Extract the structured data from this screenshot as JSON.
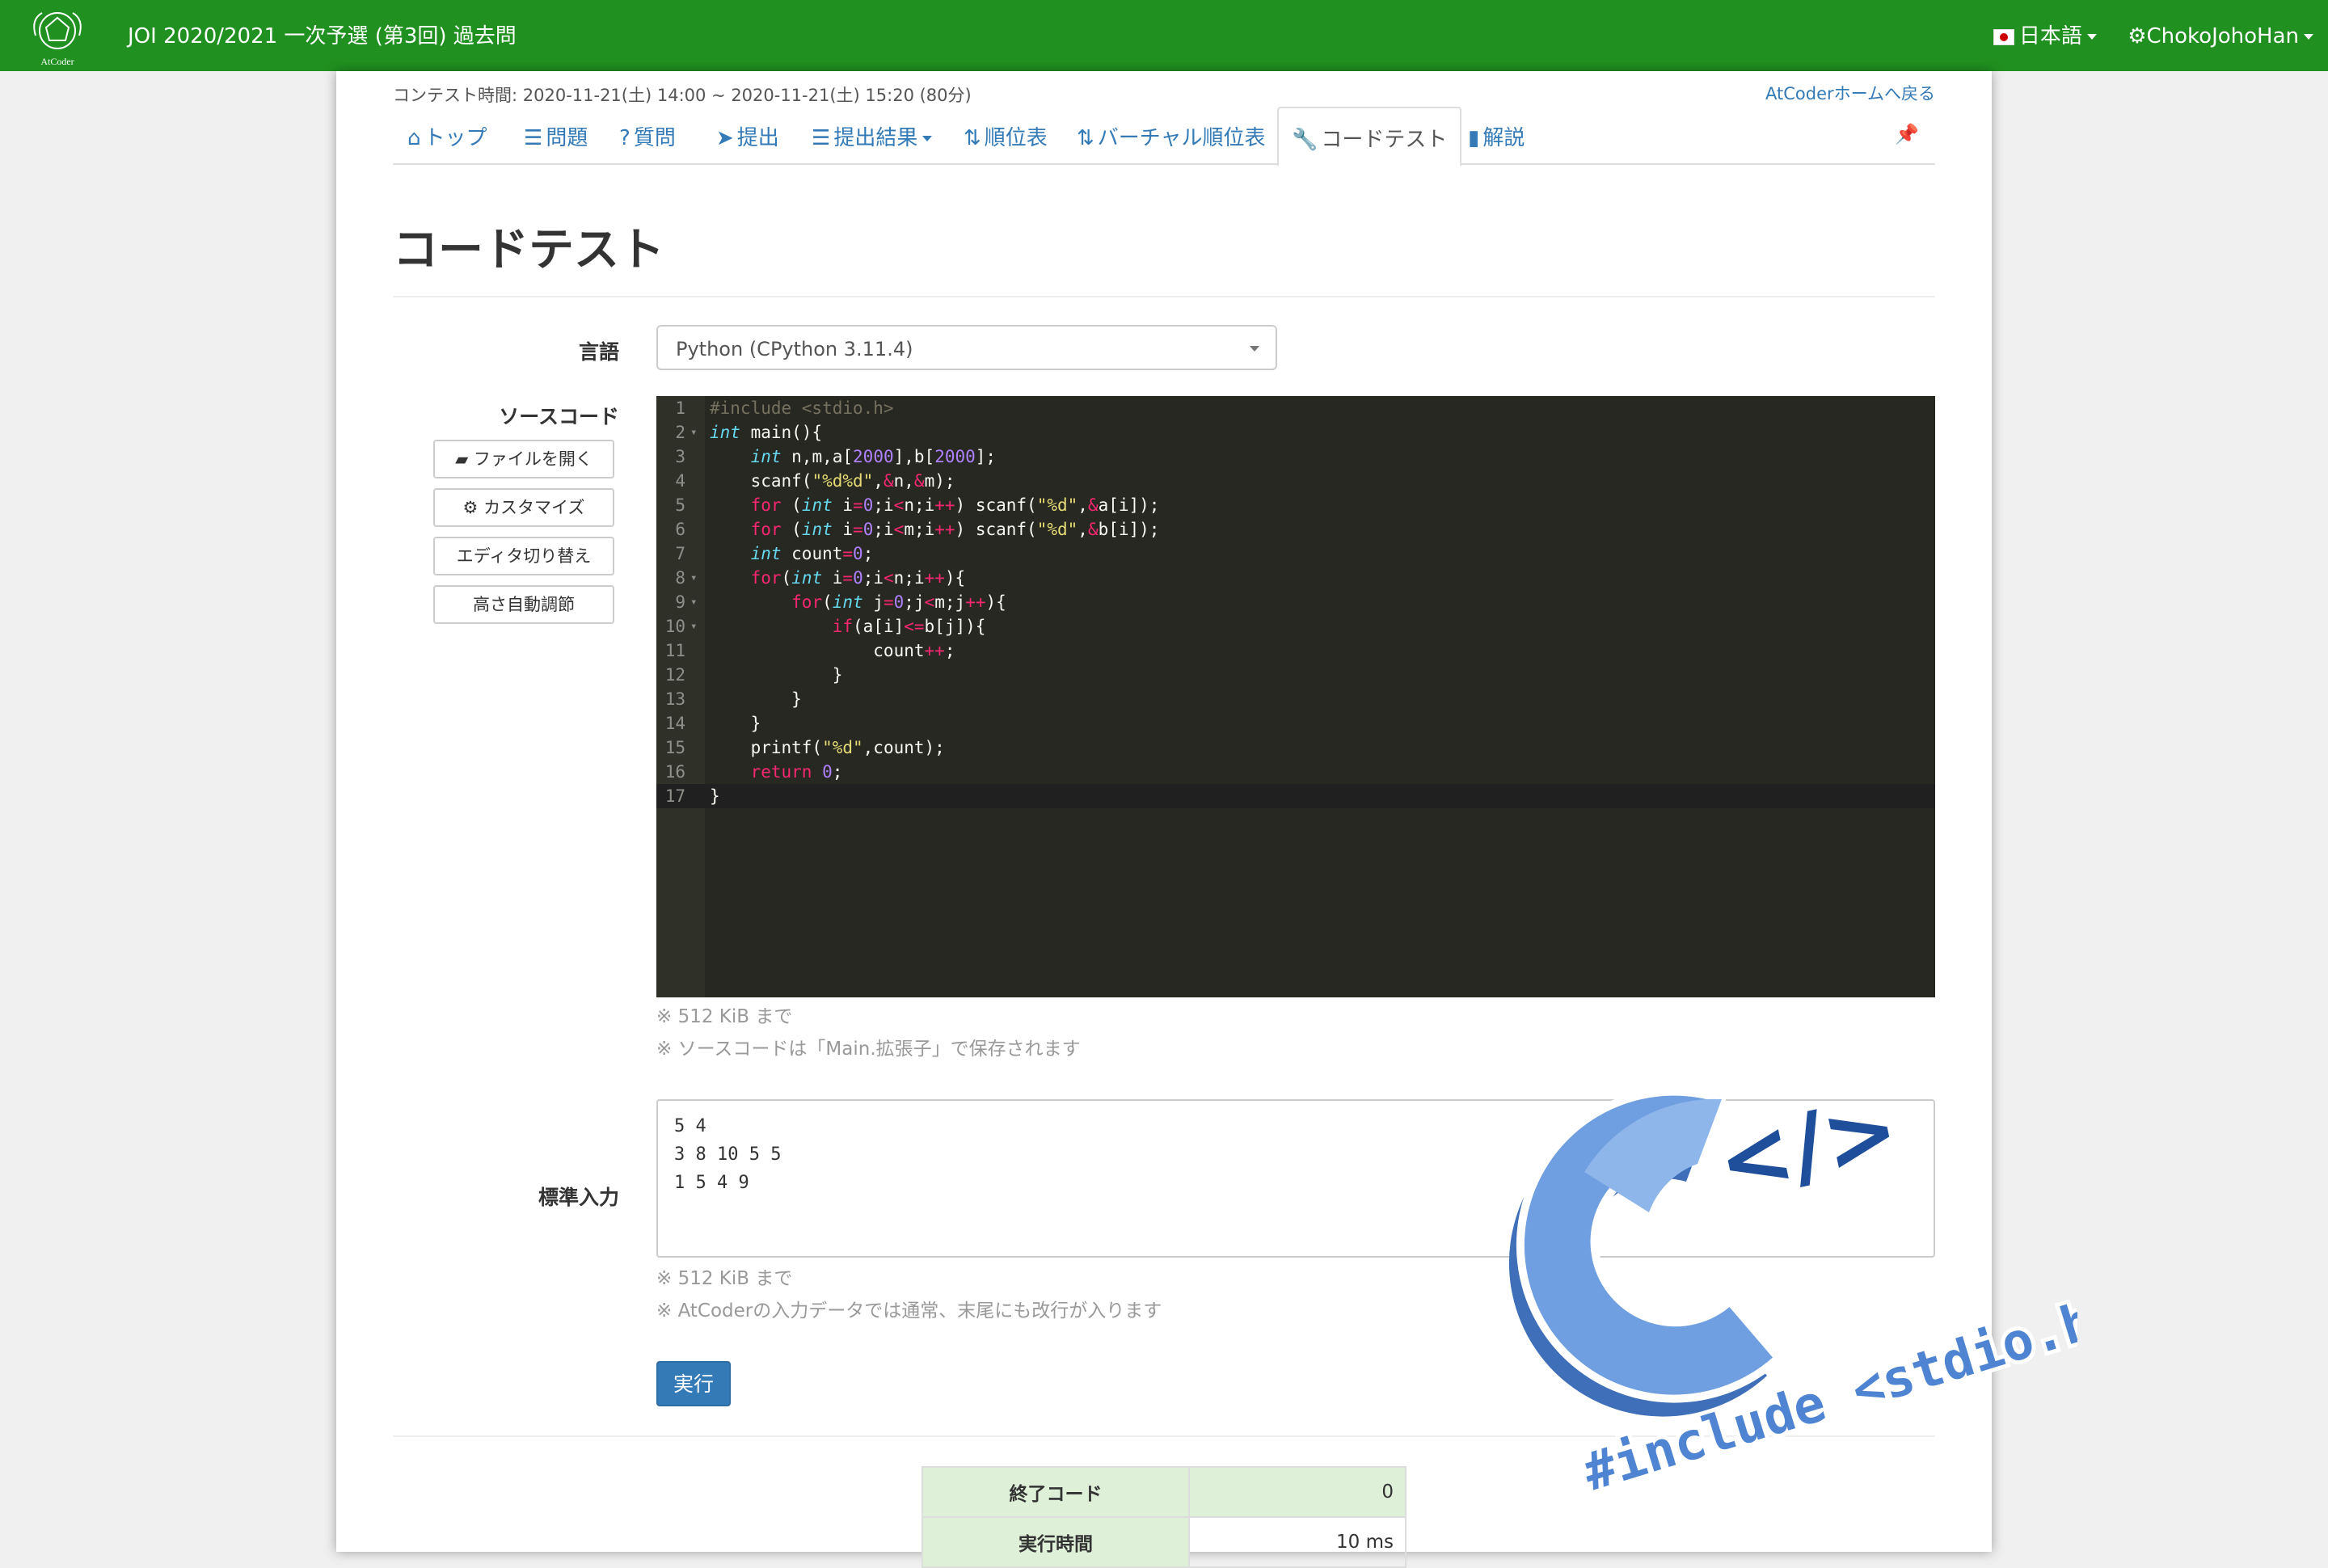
{
  "navbar": {
    "logo_text": "AtCoder",
    "title": "JOI 2020/2021 一次予選 (第3回) 過去問",
    "language": "日本語",
    "user": "ChokoJohoHan"
  },
  "contest": {
    "time_text": "コンテスト時間: 2020-11-21(土) 14:00 ~ 2020-11-21(土) 15:20 (80分)",
    "back_link": "AtCoderホームへ戻る"
  },
  "tabs": [
    {
      "label": "トップ",
      "icon": "home-icon"
    },
    {
      "label": "問題",
      "icon": "list-icon"
    },
    {
      "label": "質問",
      "icon": "question-icon"
    },
    {
      "label": "提出",
      "icon": "send-icon"
    },
    {
      "label": "提出結果",
      "icon": "list-icon"
    },
    {
      "label": "順位表",
      "icon": "sort-icon"
    },
    {
      "label": "バーチャル順位表",
      "icon": "sort-icon"
    },
    {
      "label": "コードテスト",
      "icon": "wrench-icon"
    },
    {
      "label": "解説",
      "icon": "book-icon"
    }
  ],
  "page_title": "コードテスト",
  "form": {
    "language_label": "言語",
    "language_value": "Python (CPython 3.11.4)",
    "source_label": "ソースコード",
    "buttons": {
      "open_file": "ファイルを開く",
      "customize": "カスタマイズ",
      "switch_editor": "エディタ切り替え",
      "auto_height": "高さ自動調節"
    },
    "source_notes": [
      "※ 512 KiB まで",
      "※ ソースコードは「Main.拡張子」で保存されます"
    ],
    "stdin_label": "標準入力",
    "stdin_value": "5 4\n3 8 10 5 5\n1 5 4 9",
    "stdin_notes": [
      "※ 512 KiB まで",
      "※ AtCoderの入力データでは通常、末尾にも改行が入ります"
    ],
    "run_label": "実行"
  },
  "code_lines": [
    "#include <stdio.h>",
    "int main(){",
    "    int n,m,a[2000],b[2000];",
    "    scanf(\"%d%d\",&n,&m);",
    "    for (int i=0;i<n;i++) scanf(\"%d\",&a[i]);",
    "    for (int i=0;i<m;i++) scanf(\"%d\",&b[i]);",
    "    int count=0;",
    "    for(int i=0;i<n;i++){",
    "        for(int j=0;j<m;j++){",
    "            if(a[i]<=b[j]){",
    "                count++;",
    "            }",
    "        }",
    "    }",
    "    printf(\"%d\",count);",
    "    return 0;",
    "}"
  ],
  "results": [
    {
      "label": "終了コード",
      "value": "0"
    },
    {
      "label": "実行時間",
      "value": "10 ms"
    }
  ],
  "sticker": {
    "text": "#include <stdio.h>",
    "tag": "</>"
  },
  "colors": {
    "navbar": "#209020",
    "link": "#337ab7",
    "editor_bg": "#272822",
    "sticker_blue": "#5b8fd6"
  }
}
